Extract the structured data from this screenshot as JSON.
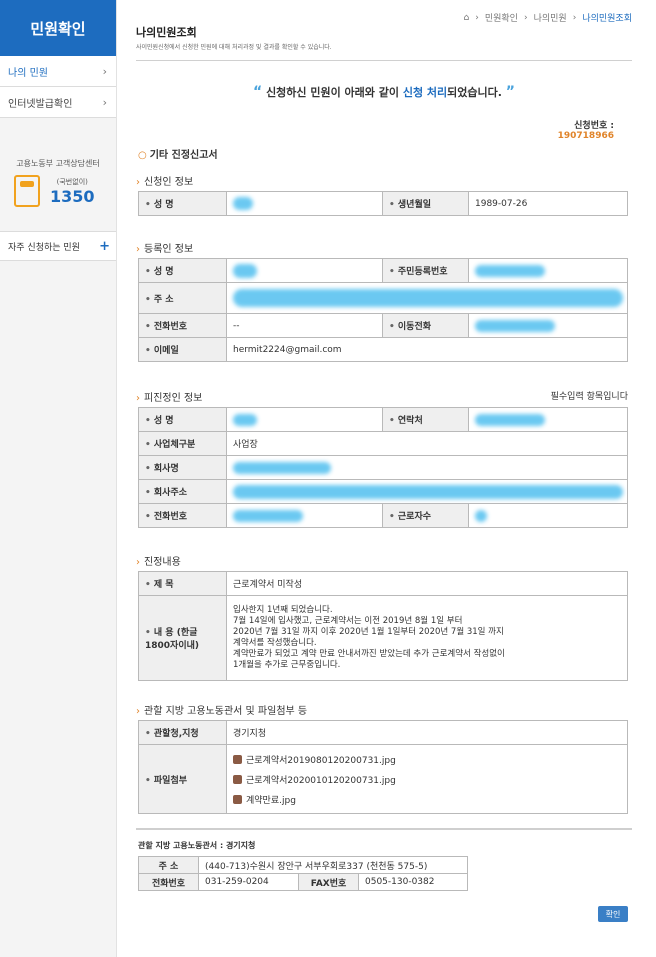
{
  "sidebar": {
    "title": "민원확인",
    "items": [
      {
        "label": "나의 민원",
        "active": true
      },
      {
        "label": "인터넷발급확인",
        "active": false
      }
    ],
    "call_center": {
      "title": "고용노동부 고객상담센터",
      "sub": "(국번없이)",
      "number": "1350"
    },
    "faq_label": "자주 신청하는 민원"
  },
  "header": {
    "title": "나의민원조회",
    "description": "사이민원신청에서 신청한 민원에 대해 처리과정 및 결과를 확인할 수 있습니다.",
    "breadcrumb": [
      "민원확인",
      "나의민원",
      "나의민원조회"
    ]
  },
  "notice": {
    "prefix": "신청하신 민원이 아래와 같이 ",
    "highlight": "신청 처리",
    "suffix": "되었습니다."
  },
  "application": {
    "number_label": "신청번호 :",
    "number": "190718966"
  },
  "document_title": "기타 진정신고서",
  "applicant": {
    "section_title": "신청인 정보",
    "name_label": "성 명",
    "name": "",
    "birth_label": "생년월일",
    "birth": "1989-07-26"
  },
  "registrant": {
    "section_title": "등록인 정보",
    "name_label": "성 명",
    "rrn_label": "주민등록번호",
    "address_label": "주 소",
    "phone_label": "전화번호",
    "phone": "--",
    "mobile_label": "이동전화",
    "email_label": "이메일",
    "email": "hermit2224@gmail.com"
  },
  "respondent": {
    "section_title": "피진정인 정보",
    "required_note": "필수입력 항목입니다",
    "name_label": "성 명",
    "contact_label": "연락처",
    "biz_type_label": "사업체구분",
    "biz_type": "사업장",
    "company_label": "회사명",
    "company_address_label": "회사주소",
    "phone_label": "전화번호",
    "employees_label": "근로자수"
  },
  "petition": {
    "section_title": "진정내용",
    "subject_label": "제 목",
    "subject": "근로계약서 미작성",
    "content_label": "내 용 (한글1800자이내)",
    "content_lines": [
      "입사한지 1년째 되었습니다.",
      "7월 14일에 입사했고, 근로계약서는 이전 2019년 8월 1일 부터",
      "2020년 7월 31일 까지 이후 2020년 1월 1일부터 2020년 7월 31일 까지",
      "계약서를 작성했습니다.",
      "계약만료가 되었고 계약 만료 안내서까진 받았는데 추가 근로계약서 작성없이",
      "1개월을 추가로 근무중입니다."
    ]
  },
  "jurisdiction": {
    "section_title": "관할 지방 고용노동관서 및 파일첨부 등",
    "office_label": "관할청,지청",
    "office": "경기지청",
    "files_label": "파일첨부",
    "files": [
      "근로계약서2019080120200731.jpg",
      "근로계약서2020010120200731.jpg",
      "계약만료.jpg"
    ]
  },
  "office_info": {
    "label": "관할 지방 고용노동관서 : 경기지청",
    "address_label": "주 소",
    "address": "(440-713)수원시 장안구 서부우회로337 (천천동 575-5)",
    "phone_label": "전화번호",
    "phone": "031-259-0204",
    "fax_label": "FAX번호",
    "fax": "0505-130-0382"
  },
  "confirm_button": "확인",
  "colors": {
    "primary": "#1d6cbf",
    "accent": "#e0842a",
    "redaction": "#5bc3f0"
  }
}
